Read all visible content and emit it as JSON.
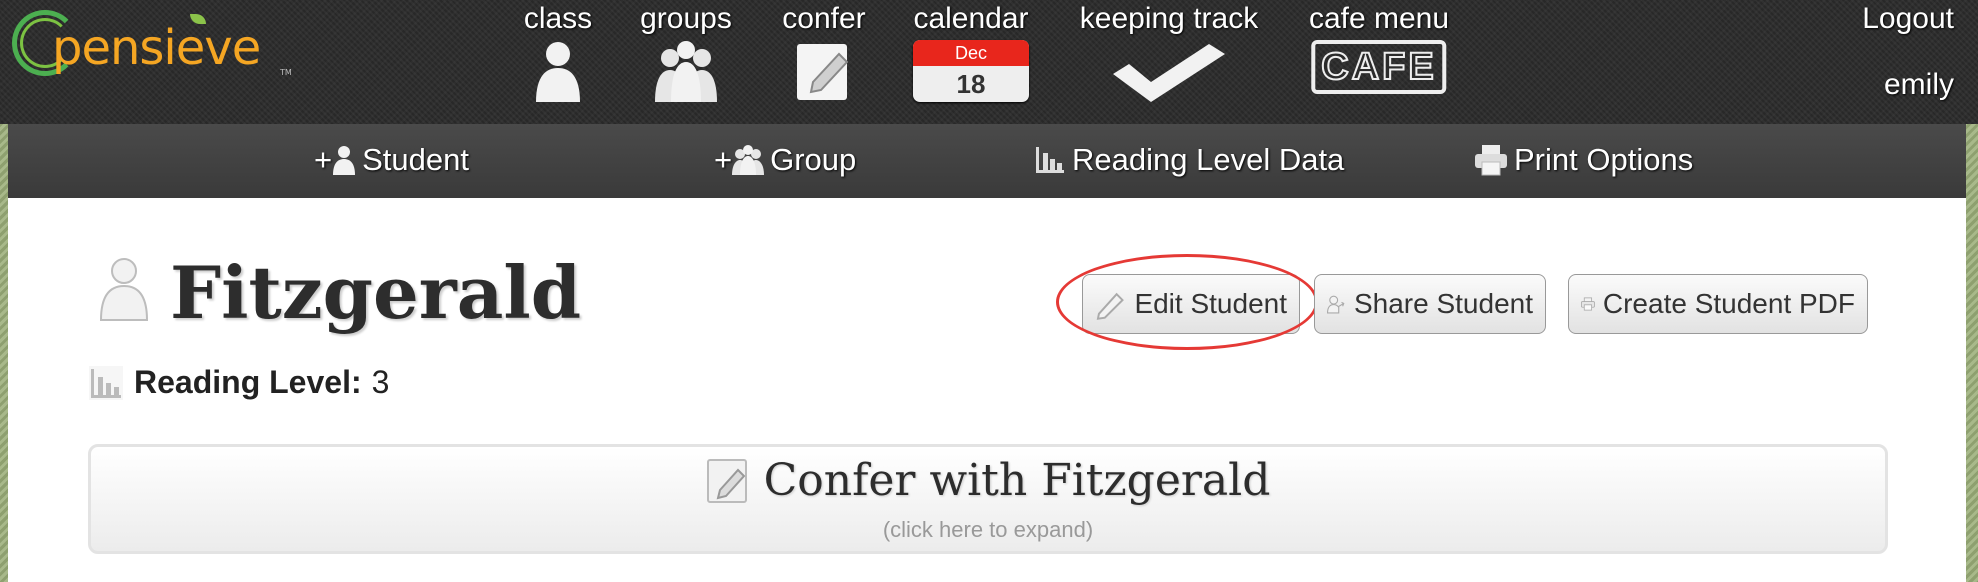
{
  "brand": {
    "name": "pensieve",
    "trademark": "TM"
  },
  "nav": {
    "items": [
      {
        "label": "class",
        "icon": "person-icon"
      },
      {
        "label": "groups",
        "icon": "group-icon"
      },
      {
        "label": "confer",
        "icon": "notepad-icon"
      },
      {
        "label": "calendar",
        "icon": "calendar-icon",
        "month": "Dec",
        "day": "18"
      },
      {
        "label": "keeping track",
        "icon": "checkmark-icon"
      },
      {
        "label": "cafe menu",
        "icon": "cafe-icon",
        "badge_text": "CAFE"
      }
    ]
  },
  "user": {
    "logout": "Logout",
    "username": "emily"
  },
  "subnav": {
    "items": [
      {
        "prefix": "+",
        "label": "Student",
        "icon": "person-icon"
      },
      {
        "prefix": "+",
        "label": "Group",
        "icon": "group-icon"
      },
      {
        "prefix": "",
        "label": "Reading Level Data",
        "icon": "bar-chart-icon"
      },
      {
        "prefix": "",
        "label": "Print Options",
        "icon": "printer-icon"
      }
    ]
  },
  "student": {
    "name": "Fitzgerald",
    "reading_level_label": "Reading Level:",
    "reading_level_value": "3"
  },
  "actions": {
    "edit": "Edit Student",
    "share": "Share Student",
    "pdf": "Create Student PDF"
  },
  "confer_panel": {
    "title": "Confer with Fitzgerald",
    "subtitle": "(click here to expand)"
  },
  "colors": {
    "topbar_bg": "#2b2b2b",
    "subbar_bg": "#444444",
    "logo_orange": "#f5a623",
    "logo_green": "#4caf50",
    "calendar_red": "#e8261c",
    "highlight_red": "#e53935"
  }
}
